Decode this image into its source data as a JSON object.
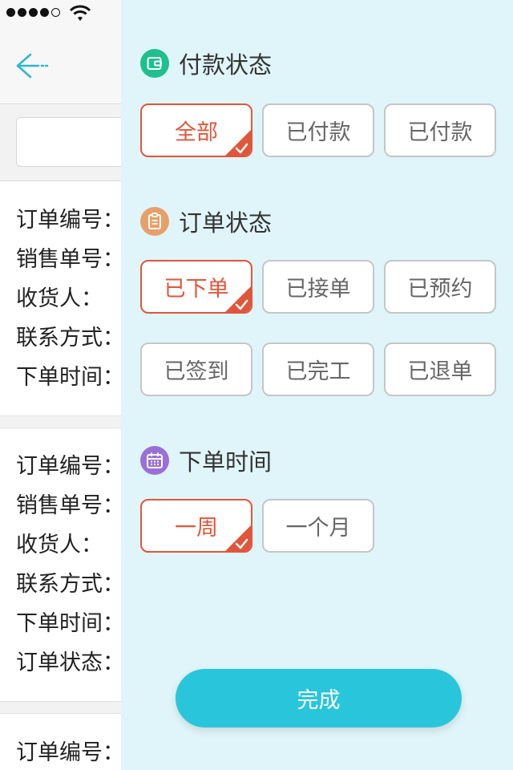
{
  "background": {
    "card1": [
      "订单编号：",
      "销售单号：",
      "收货人：",
      "联系方式：",
      "下单时间："
    ],
    "card2": [
      "订单编号：",
      "销售单号：",
      "收货人：",
      "联系方式：",
      "下单时间：",
      "订单状态："
    ],
    "card3": [
      "订单编号："
    ]
  },
  "filter": {
    "payment": {
      "title": "付款状态",
      "icon": "wallet-icon",
      "options": [
        "全部",
        "已付款",
        "已付款"
      ],
      "selected_index": 0
    },
    "order": {
      "title": "订单状态",
      "icon": "clipboard-icon",
      "options": [
        "已下单",
        "已接单",
        "已预约",
        "已签到",
        "已完工",
        "已退单"
      ],
      "selected_index": 0
    },
    "time": {
      "title": "下单时间",
      "icon": "calendar-icon",
      "options": [
        "一周",
        "一个月"
      ],
      "selected_index": 0
    },
    "done_label": "完成"
  },
  "colors": {
    "accent": "#29c6db",
    "selected": "#e0563b",
    "drawer_bg": "#e0f5f9"
  }
}
